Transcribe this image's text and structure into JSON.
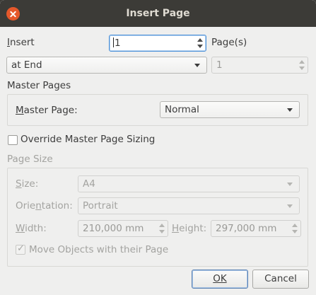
{
  "window": {
    "title": "Insert Page",
    "close_icon": "close-icon"
  },
  "insert": {
    "label": "Insert",
    "count_value": "1",
    "pages_label": "Page(s)",
    "position_value": "at End",
    "position_page_value": "1"
  },
  "master_pages": {
    "section_label": "Master Pages",
    "master_page_label": "Master Page:",
    "master_page_value": "Normal"
  },
  "override": {
    "label": "Override Master Page Sizing",
    "checked": false
  },
  "page_size": {
    "section_label": "Page Size",
    "size_label": "Size:",
    "size_value": "A4",
    "orientation_label": "Orientation:",
    "orientation_value": "Portrait",
    "width_label": "Width:",
    "width_value": "210,000 mm",
    "height_label": "Height:",
    "height_value": "297,000 mm",
    "move_objects_label": "Move Objects with their Page",
    "move_objects_checked": true
  },
  "buttons": {
    "ok_label": "OK",
    "cancel_label": "Cancel"
  }
}
